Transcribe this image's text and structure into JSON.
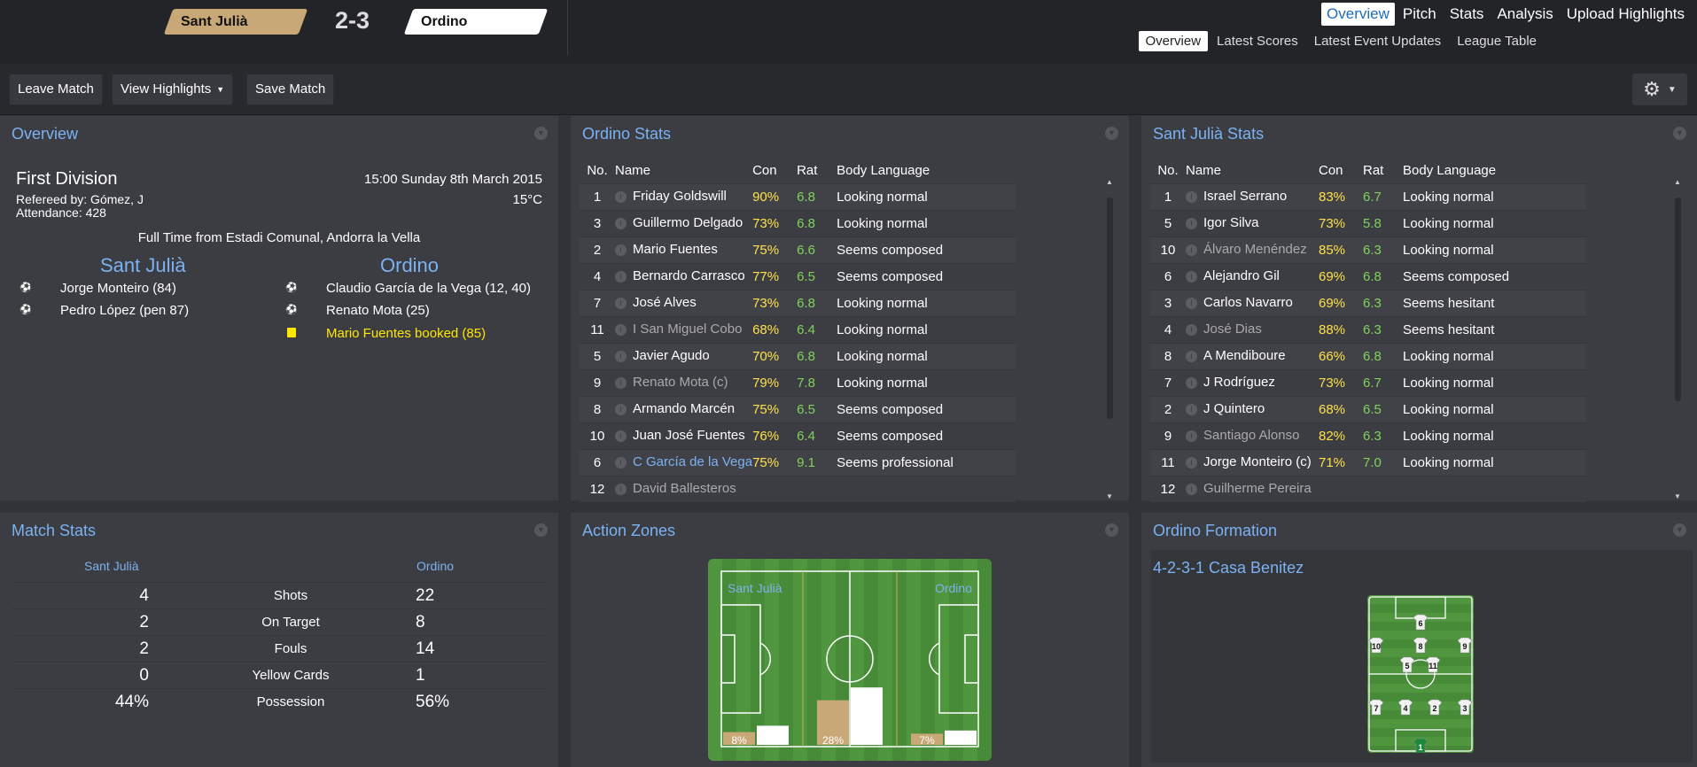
{
  "header": {
    "home_team": "Sant Julià",
    "away_team": "Ordino",
    "score": "2-3",
    "nav_primary": [
      "Overview",
      "Pitch",
      "Stats",
      "Analysis",
      "Upload Highlights"
    ],
    "nav_secondary": [
      "Overview",
      "Latest Scores",
      "Latest Event Updates",
      "League Table"
    ]
  },
  "toolbar": {
    "leave_match": "Leave Match",
    "view_highlights": "View Highlights",
    "save_match": "Save Match",
    "settings_icon": "gear-icon"
  },
  "overview": {
    "title": "Overview",
    "league": "First Division",
    "referee": "Refereed by: Gómez, J",
    "attendance": "Attendance: 428",
    "datetime": "15:00 Sunday 8th March 2015",
    "temperature": "15°C",
    "full_time": "Full Time from Estadi Comunal, Andorra la Vella",
    "home_name": "Sant Julià",
    "away_name": "Ordino",
    "home_events": [
      "Jorge Monteiro (84)",
      "Pedro López (pen 87)"
    ],
    "away_events": [
      "Claudio García de la Vega (12, 40)",
      "Renato Mota (25)",
      "Mario Fuentes booked (85)"
    ]
  },
  "ordino_stats": {
    "title": "Ordino Stats",
    "columns": [
      "No.",
      "Name",
      "Con",
      "Rat",
      "Body Language"
    ],
    "rows": [
      {
        "no": "1",
        "name": "Friday Goldswill",
        "con": "90%",
        "rat": "6.8",
        "bl": "Looking normal"
      },
      {
        "no": "3",
        "name": "Guillermo Delgado",
        "con": "73%",
        "rat": "6.8",
        "bl": "Looking normal"
      },
      {
        "no": "2",
        "name": "Mario Fuentes",
        "con": "75%",
        "rat": "6.6",
        "bl": "Seems composed"
      },
      {
        "no": "4",
        "name": "Bernardo Carrasco",
        "con": "77%",
        "rat": "6.5",
        "bl": "Seems composed"
      },
      {
        "no": "7",
        "name": "José Alves",
        "con": "73%",
        "rat": "6.8",
        "bl": "Looking normal"
      },
      {
        "no": "11",
        "name": "I San Miguel Cobo",
        "con": "68%",
        "rat": "6.4",
        "bl": "Looking normal"
      },
      {
        "no": "5",
        "name": "Javier Agudo",
        "con": "70%",
        "rat": "6.8",
        "bl": "Looking normal"
      },
      {
        "no": "9",
        "name": "Renato Mota (c)",
        "con": "79%",
        "rat": "7.8",
        "bl": "Looking normal"
      },
      {
        "no": "8",
        "name": "Armando Marcén",
        "con": "75%",
        "rat": "6.5",
        "bl": "Seems composed"
      },
      {
        "no": "10",
        "name": "Juan José Fuentes",
        "con": "76%",
        "rat": "6.4",
        "bl": "Seems composed"
      },
      {
        "no": "6",
        "name": "C García de la Vega",
        "con": "75%",
        "rat": "9.1",
        "bl": "Seems professional"
      },
      {
        "no": "12",
        "name": "David Ballesteros",
        "con": "",
        "rat": "",
        "bl": ""
      }
    ]
  },
  "santjulia_stats": {
    "title": "Sant Julià Stats",
    "columns": [
      "No.",
      "Name",
      "Con",
      "Rat",
      "Body Language"
    ],
    "rows": [
      {
        "no": "1",
        "name": "Israel Serrano",
        "con": "83%",
        "rat": "6.7",
        "bl": "Looking normal"
      },
      {
        "no": "5",
        "name": "Igor Silva",
        "con": "73%",
        "rat": "5.8",
        "bl": "Looking normal"
      },
      {
        "no": "10",
        "name": "Álvaro Menéndez",
        "con": "85%",
        "rat": "6.3",
        "bl": "Looking normal"
      },
      {
        "no": "6",
        "name": "Alejandro Gil",
        "con": "69%",
        "rat": "6.8",
        "bl": "Seems composed"
      },
      {
        "no": "3",
        "name": "Carlos Navarro",
        "con": "69%",
        "rat": "6.3",
        "bl": "Seems hesitant"
      },
      {
        "no": "4",
        "name": "José Dias",
        "con": "88%",
        "rat": "6.3",
        "bl": "Seems hesitant"
      },
      {
        "no": "8",
        "name": "A Mendiboure",
        "con": "66%",
        "rat": "6.8",
        "bl": "Looking normal"
      },
      {
        "no": "7",
        "name": "J Rodríguez",
        "con": "73%",
        "rat": "6.7",
        "bl": "Looking normal"
      },
      {
        "no": "2",
        "name": "J Quintero",
        "con": "68%",
        "rat": "6.5",
        "bl": "Looking normal"
      },
      {
        "no": "9",
        "name": "Santiago Alonso",
        "con": "82%",
        "rat": "6.3",
        "bl": "Looking normal"
      },
      {
        "no": "11",
        "name": "Jorge Monteiro (c)",
        "con": "71%",
        "rat": "7.0",
        "bl": "Looking normal"
      },
      {
        "no": "12",
        "name": "Guilherme Pereira",
        "con": "",
        "rat": "",
        "bl": ""
      }
    ]
  },
  "match_stats": {
    "title": "Match Stats",
    "home_label": "Sant Julià",
    "away_label": "Ordino",
    "rows": [
      {
        "label": "Shots",
        "home": "4",
        "away": "22"
      },
      {
        "label": "On Target",
        "home": "2",
        "away": "8"
      },
      {
        "label": "Fouls",
        "home": "2",
        "away": "14"
      },
      {
        "label": "Yellow Cards",
        "home": "0",
        "away": "1"
      },
      {
        "label": "Possession",
        "home": "44%",
        "away": "56%"
      }
    ]
  },
  "action_zones": {
    "title": "Action Zones",
    "home_label": "Sant Julià",
    "away_label": "Ordino",
    "home_color": "#c9a877",
    "away_color": "#ffffff",
    "zones": [
      {
        "home": 8,
        "away": 12,
        "home_label": "8%",
        "away_label": "12%"
      },
      {
        "home": 28,
        "away": 36,
        "home_label": "28%",
        "away_label": "36%"
      },
      {
        "home": 7,
        "away": 9,
        "home_label": "7%",
        "away_label": "9%"
      }
    ]
  },
  "formation": {
    "title": "Ordino Formation",
    "name": "4-2-3-1 Casa Benitez",
    "players": [
      "6",
      "10",
      "8",
      "9",
      "5",
      "11",
      "7",
      "4",
      "2",
      "3",
      "1"
    ]
  }
}
